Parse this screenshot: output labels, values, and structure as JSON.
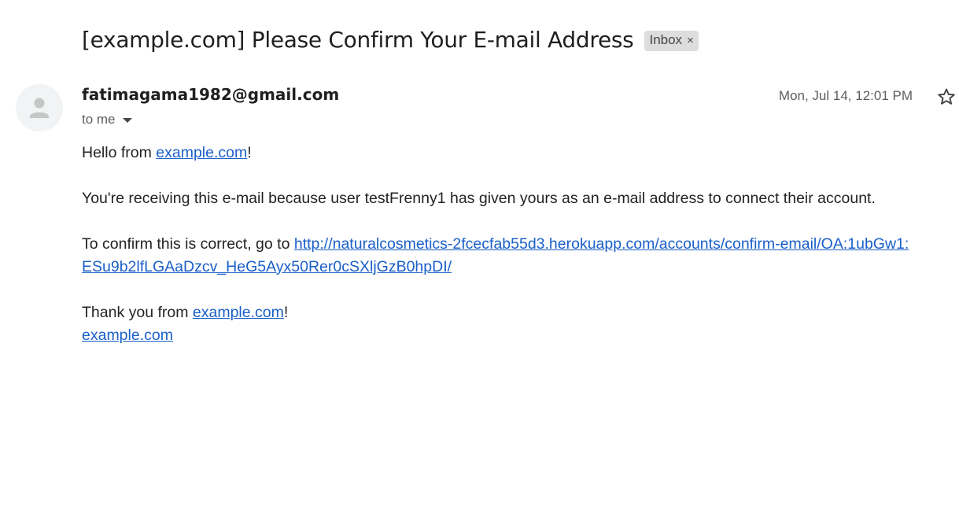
{
  "email": {
    "subject": "[example.com] Please Confirm Your E-mail Address",
    "label": "Inbox",
    "label_close": "×",
    "sender": "fatimagama1982@gmail.com",
    "recipient": "to me",
    "date": "Mon, Jul 14, 12:01 PM"
  },
  "body": {
    "line1_prefix": "Hello from ",
    "line1_link": "example.com",
    "line1_suffix": "!",
    "line2": "You're receiving this e-mail because user testFrenny1 has given yours as an e-mail address to connect their account.",
    "line3_prefix": "To confirm this is correct, go to ",
    "line3_link_part1": "http://naturalcosmetics-2fcecfab55d3.herokuapp.com/accounts/confirm-email/OA:1ubGw1:",
    "line3_link_part2": "ESu9b2lfLGAaDzcv_HeG5Ayx50Rer0cSXljGzB0hpDI/",
    "line4_prefix": "Thank you from ",
    "line4_link": "example.com",
    "line4_suffix": "!",
    "line5_link": "example.com"
  },
  "icons": {
    "avatar": "person-icon",
    "star": "star-icon",
    "caret": "caret-down-icon",
    "close": "close-icon"
  },
  "colors": {
    "link": "#1a5fc9",
    "chip_bg": "#dddddd",
    "avatar_bg": "#f1f3f4"
  }
}
